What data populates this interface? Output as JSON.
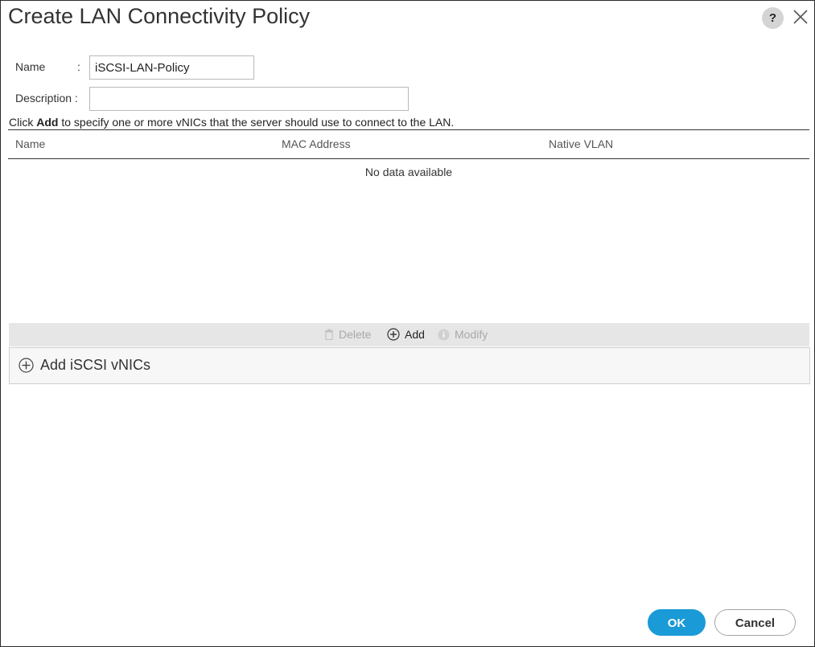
{
  "dialog": {
    "title": "Create LAN Connectivity Policy",
    "help_label": "?"
  },
  "form": {
    "name_label": "Name",
    "name_colon": ":",
    "name_value": "iSCSI-LAN-Policy",
    "description_label": "Description :",
    "description_value": ""
  },
  "instructions": {
    "prefix": "Click",
    "keyword": "Add",
    "suffix": "to specify one or more vNICs that the server should use to connect to the LAN."
  },
  "table": {
    "columns": [
      "Name",
      "MAC Address",
      "Native VLAN"
    ],
    "empty_message": "No data available"
  },
  "toolbar": {
    "delete_label": "Delete",
    "add_label": "Add",
    "modify_label": "Modify"
  },
  "iscsi_panel": {
    "label": "Add iSCSI vNICs"
  },
  "footer": {
    "ok_label": "OK",
    "cancel_label": "Cancel"
  },
  "colors": {
    "primary": "#1a9ad6",
    "toolbar_bg": "#e6e6e6",
    "disabled_text": "#a8a8a8"
  },
  "icons": [
    "help-icon",
    "close-icon",
    "trash-icon",
    "plus-circle-icon",
    "info-icon"
  ]
}
